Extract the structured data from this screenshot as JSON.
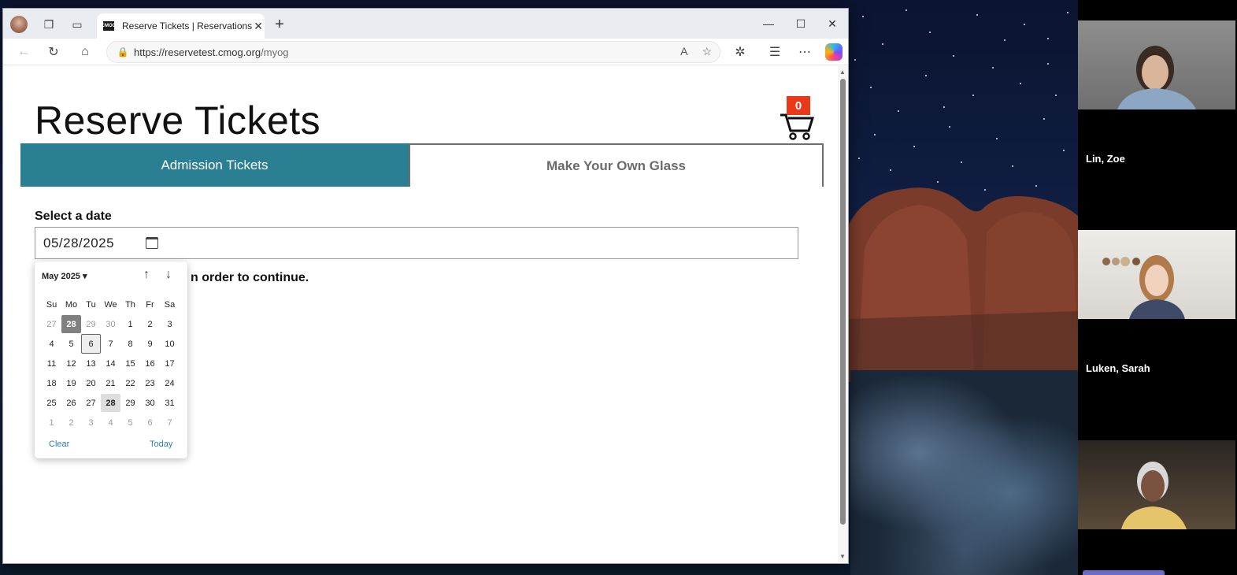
{
  "browser": {
    "tab_title": "Reserve Tickets | Reservations",
    "tab_favicon_text": "CMOG",
    "url_host": "https://reservetest.cmog.org",
    "url_path": "/myog"
  },
  "page": {
    "title": "Reserve Tickets",
    "cart_count": "0",
    "tabs": [
      {
        "label": "Admission Tickets",
        "active": true
      },
      {
        "label": "Make Your Own Glass",
        "active": false
      }
    ],
    "date_label": "Select a date",
    "date_value": "05/28/2025",
    "partial_message": "n order to continue."
  },
  "datepicker": {
    "month_label": "May 2025",
    "weekdays": [
      "Su",
      "Mo",
      "Tu",
      "We",
      "Th",
      "Fr",
      "Sa"
    ],
    "weeks": [
      [
        "27",
        "28",
        "29",
        "30",
        "1",
        "2",
        "3"
      ],
      [
        "4",
        "5",
        "6",
        "7",
        "8",
        "9",
        "10"
      ],
      [
        "11",
        "12",
        "13",
        "14",
        "15",
        "16",
        "17"
      ],
      [
        "18",
        "19",
        "20",
        "21",
        "22",
        "23",
        "24"
      ],
      [
        "25",
        "26",
        "27",
        "28",
        "29",
        "30",
        "31"
      ],
      [
        "1",
        "2",
        "3",
        "4",
        "5",
        "6",
        "7"
      ]
    ],
    "clear_label": "Clear",
    "today_label": "Today"
  },
  "participants": [
    {
      "name": "Lin, Zoe"
    },
    {
      "name": "Luken, Sarah"
    }
  ],
  "colors": {
    "accent": "#2a7f92",
    "cart_badge": "#e8391a",
    "link": "#2a7fb8"
  }
}
